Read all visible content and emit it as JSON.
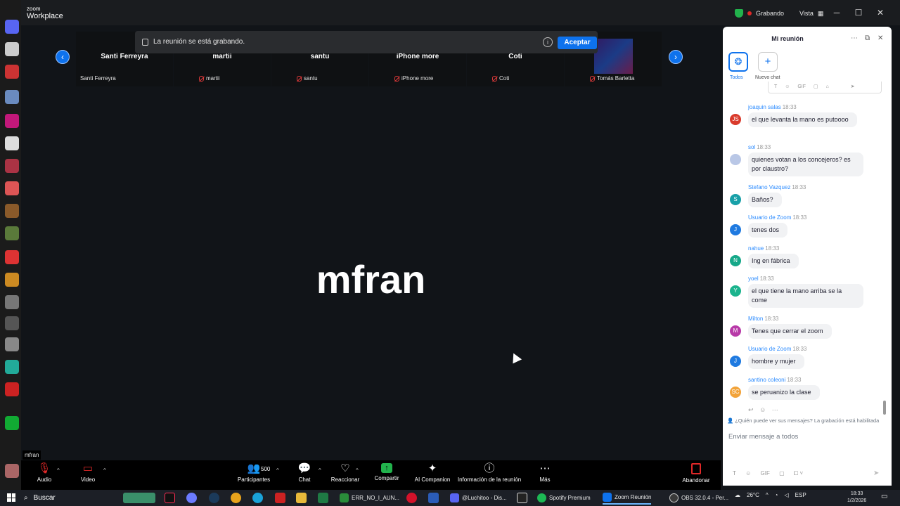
{
  "app": {
    "logo_top": "zoom",
    "logo_bottom": "Workplace",
    "recording_label": "Grabando",
    "view_label": "Vista"
  },
  "banner": {
    "text": "La reunión se está grabando.",
    "accept_label": "Aceptar"
  },
  "gallery": {
    "tiles": [
      {
        "name": "Santi Ferreyra",
        "tag": "Santi Ferreyra",
        "muted": false
      },
      {
        "name": "martii",
        "tag": "martii",
        "muted": true
      },
      {
        "name": "santu",
        "tag": "santu",
        "muted": true
      },
      {
        "name": "iPhone more",
        "tag": "iPhone more",
        "muted": true
      },
      {
        "name": "Coti",
        "tag": "Coti",
        "muted": true
      },
      {
        "name": "",
        "tag": "Tomás Barletta",
        "muted": true
      }
    ]
  },
  "speaker": {
    "name": "mfran",
    "label": "mfran"
  },
  "toolbar": {
    "audio": "Audio",
    "video": "Video",
    "participants": "Participantes",
    "participants_count": "500",
    "chat": "Chat",
    "react": "Reaccionar",
    "share": "Compartir",
    "ai": "AI Companion",
    "info": "Información de la reunión",
    "more": "Más",
    "leave": "Abandonar"
  },
  "chat": {
    "title": "Mi reunión",
    "tab_all": "Todos",
    "tab_new": "Nuevo chat",
    "messages": [
      {
        "initials": "JS",
        "color": "#d93a2b",
        "sender": "joaquin salas",
        "time": "18:33",
        "text": "el que levanta la mano es putoooo"
      },
      {
        "initials": "",
        "color": "#b9c7e6",
        "sender": "sol",
        "time": "18:33",
        "text": "quienes votan a los concejeros? es por claustro?"
      },
      {
        "initials": "S",
        "color": "#18a0a8",
        "sender": "Stefano Vazquez",
        "time": "18:33",
        "text": "Baños?"
      },
      {
        "initials": "J",
        "color": "#1f7ae0",
        "sender": "Usuario de Zoom",
        "time": "18:33",
        "text": "tenes dos"
      },
      {
        "initials": "N",
        "color": "#16a889",
        "sender": "nahue",
        "time": "18:33",
        "text": "Ing en fábrica"
      },
      {
        "initials": "Y",
        "color": "#1bb38d",
        "sender": "yoel",
        "time": "18:33",
        "text": "el que tiene la mano arriba se la come"
      },
      {
        "initials": "M",
        "color": "#b83aa8",
        "sender": "Milton",
        "time": "18:33",
        "text": "Tenes que cerrar el zoom"
      },
      {
        "initials": "J",
        "color": "#1f7ae0",
        "sender": "Usuario de Zoom",
        "time": "18:33",
        "text": "hombre y mujer"
      },
      {
        "initials": "SC",
        "color": "#f2a33a",
        "sender": "santino coleoni",
        "time": "18:33",
        "text": "se peruanizo la clase"
      }
    ],
    "privacy_note": "¿Quién puede ver sus mensajes? La grabación está habilitada",
    "input_placeholder": "Enviar mensaje a todos"
  },
  "taskbar": {
    "search": "Buscar",
    "apps": [
      {
        "label": "ERR_NO_I_AUN...",
        "color": "#2a8c3a"
      },
      {
        "label": "@Luchitoo - Dis...",
        "color": "#5865f2"
      },
      {
        "label": "Spotify Premium",
        "color": "#1db954"
      },
      {
        "label": "Zoom Reunión",
        "color": "#0e72ed"
      },
      {
        "label": "OBS 32.0.4 - Per...",
        "color": "#3a3a3a"
      }
    ],
    "weather": "26°C",
    "lang": "ESP",
    "time": "18:33",
    "date": "1/2/2026"
  }
}
